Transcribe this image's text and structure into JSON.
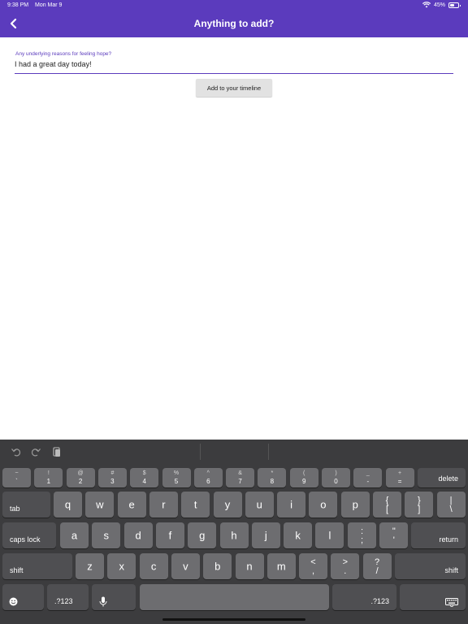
{
  "status_bar": {
    "time": "9:38 PM",
    "date": "Mon Mar 9",
    "battery": "45%",
    "battery_level": 0.45
  },
  "nav": {
    "title": "Anything to add?"
  },
  "form": {
    "label": "Any underlying reasons for feeling hope?",
    "value": "I had a great day today!",
    "button": "Add to your timeline"
  },
  "keyboard": {
    "row1": [
      {
        "top": "~",
        "bottom": "`"
      },
      {
        "top": "!",
        "bottom": "1"
      },
      {
        "top": "@",
        "bottom": "2"
      },
      {
        "top": "#",
        "bottom": "3"
      },
      {
        "top": "$",
        "bottom": "4"
      },
      {
        "top": "%",
        "bottom": "5"
      },
      {
        "top": "^",
        "bottom": "6"
      },
      {
        "top": "&",
        "bottom": "7"
      },
      {
        "top": "*",
        "bottom": "8"
      },
      {
        "top": "(",
        "bottom": "9"
      },
      {
        "top": ")",
        "bottom": "0"
      },
      {
        "top": "_",
        "bottom": "-"
      },
      {
        "top": "+",
        "bottom": "="
      }
    ],
    "delete": "delete",
    "tab": "tab",
    "row2": [
      "q",
      "w",
      "e",
      "r",
      "t",
      "y",
      "u",
      "i",
      "o",
      "p"
    ],
    "row2_sym": [
      {
        "top": "{",
        "bottom": "["
      },
      {
        "top": "}",
        "bottom": "]"
      },
      {
        "top": "|",
        "bottom": "\\"
      }
    ],
    "caps": "caps lock",
    "row3": [
      "a",
      "s",
      "d",
      "f",
      "g",
      "h",
      "j",
      "k",
      "l"
    ],
    "row3_sym": [
      {
        "top": ":",
        "bottom": ";"
      },
      {
        "top": "\"",
        "bottom": "'"
      }
    ],
    "return": "return",
    "shift": "shift",
    "row4": [
      "z",
      "x",
      "c",
      "v",
      "b",
      "n",
      "m"
    ],
    "row4_sym": [
      {
        "top": "<",
        "bottom": ","
      },
      {
        "top": ">",
        "bottom": "."
      },
      {
        "top": "?",
        "bottom": "/"
      }
    ],
    "numbers": ".?123",
    "icons": {
      "undo": "undo-icon",
      "redo": "redo-icon",
      "paste": "paste-icon",
      "emoji": "emoji-icon",
      "mic": "microphone-icon",
      "hide": "keyboard-dismiss-icon"
    }
  }
}
